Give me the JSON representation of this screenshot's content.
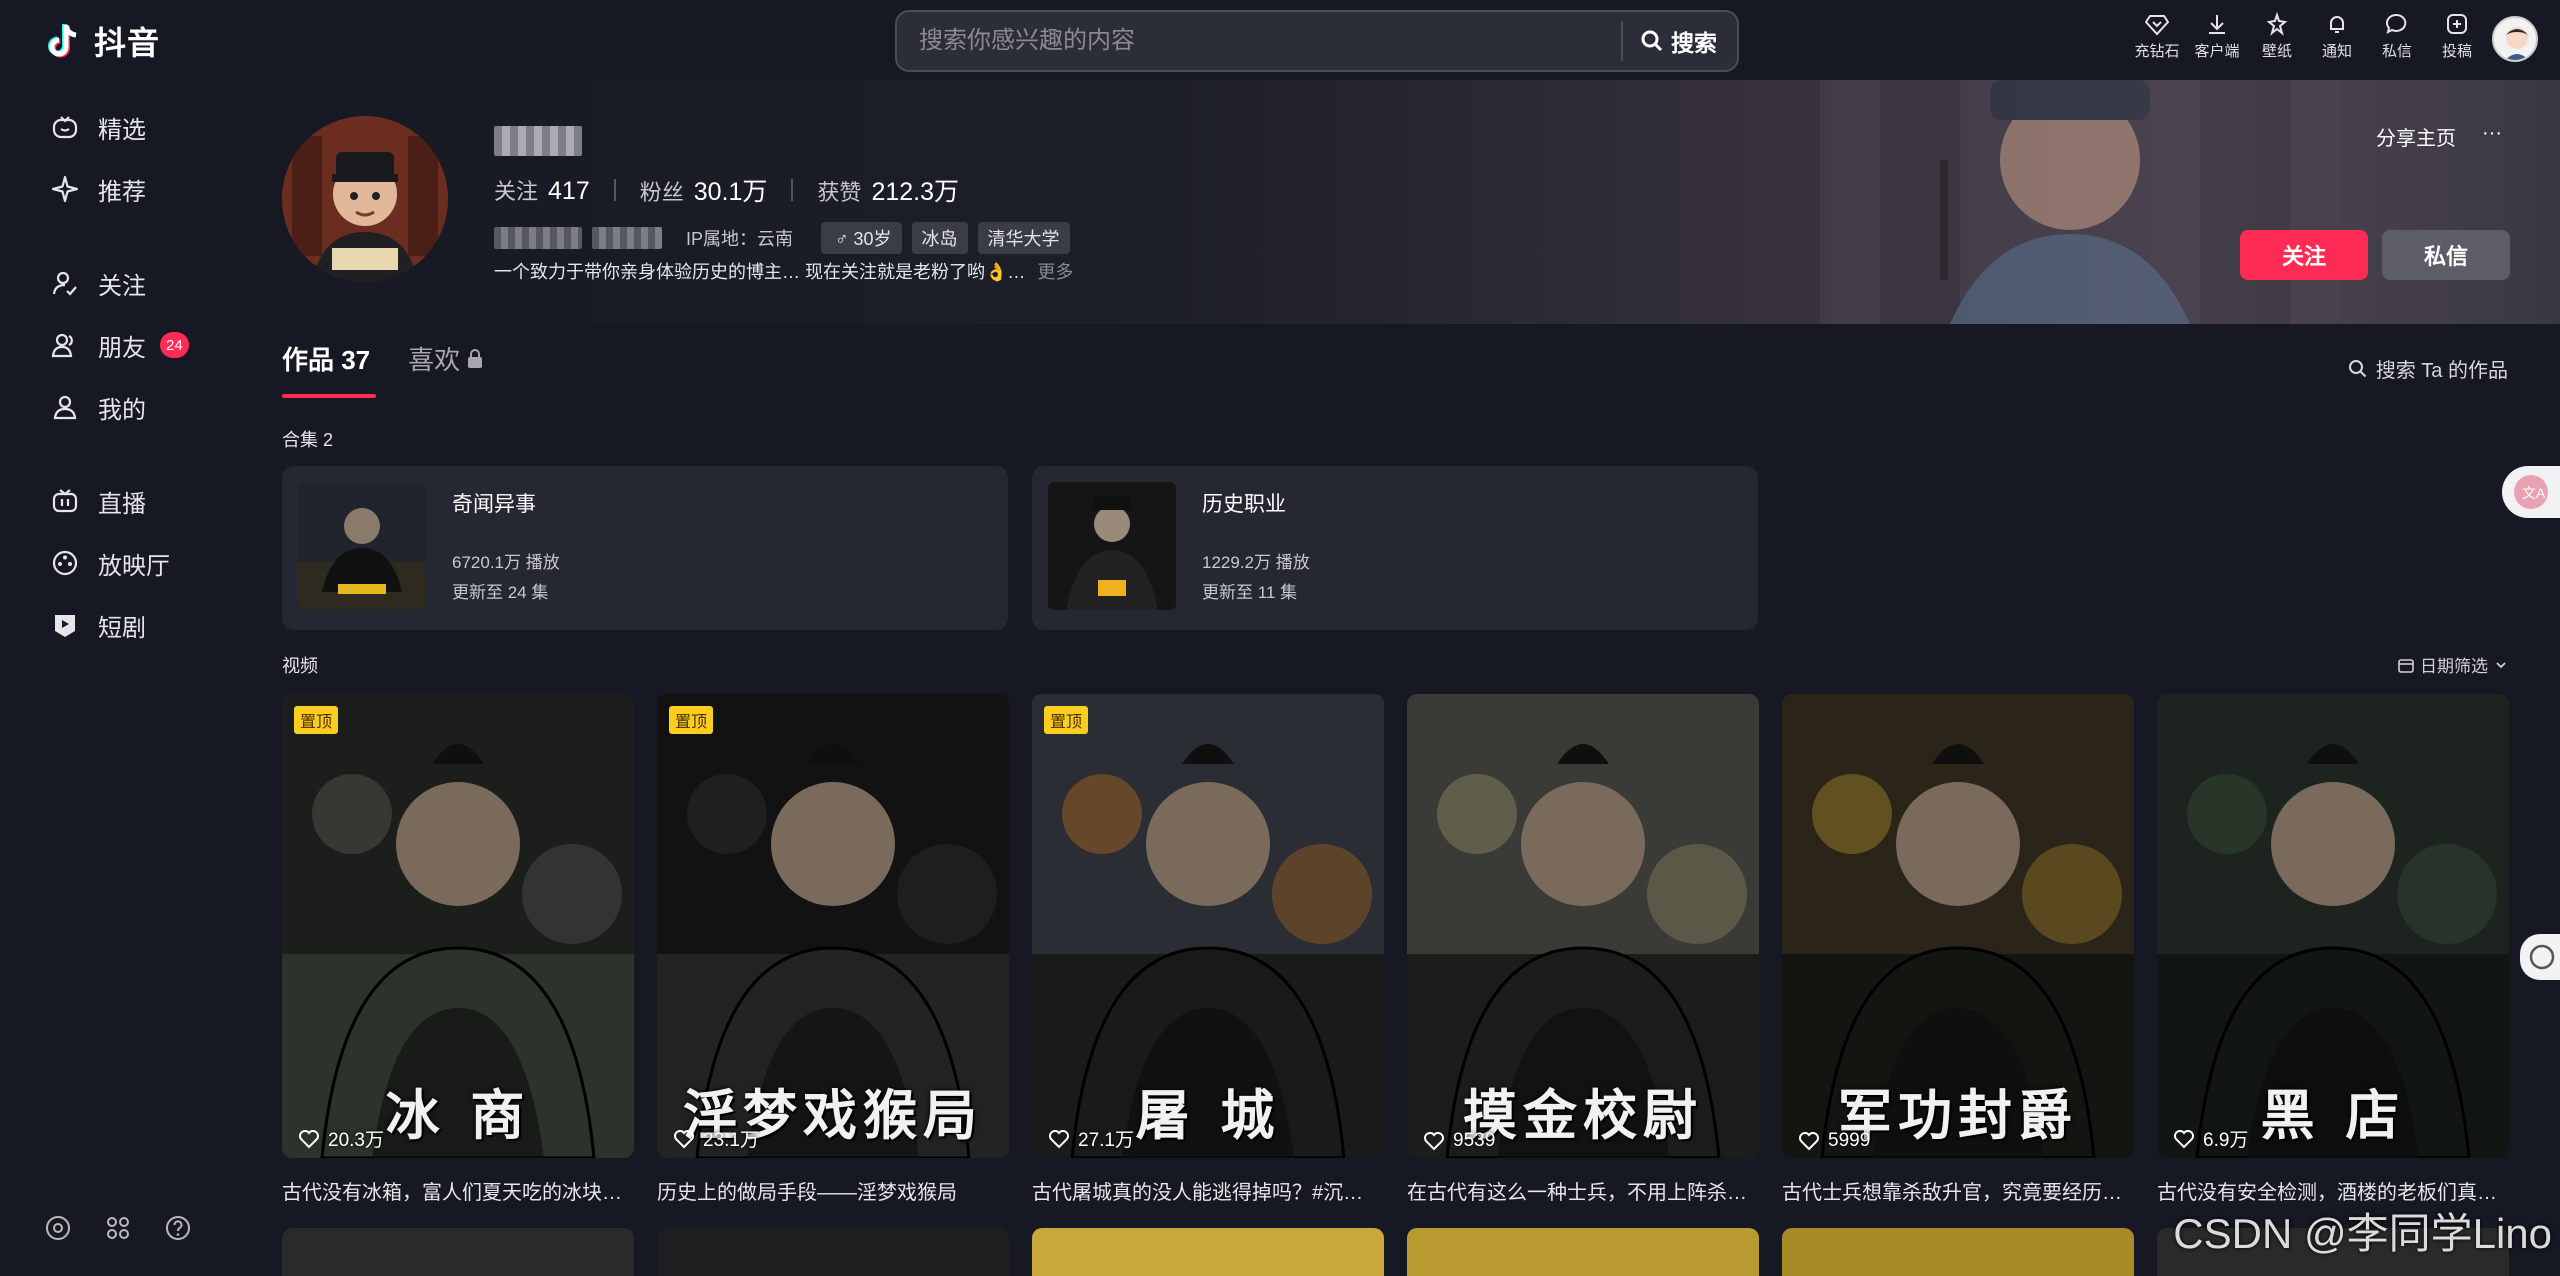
{
  "app": {
    "logo_text": "抖音"
  },
  "sidebar": {
    "items": [
      {
        "label": "精选",
        "icon": "tv-smile-icon"
      },
      {
        "label": "推荐",
        "icon": "sparkle-icon"
      },
      {
        "label": "关注",
        "icon": "user-follow-icon"
      },
      {
        "label": "朋友",
        "icon": "friends-icon",
        "badge": "24"
      },
      {
        "label": "我的",
        "icon": "user-icon"
      },
      {
        "label": "直播",
        "icon": "live-tv-icon"
      },
      {
        "label": "放映厅",
        "icon": "film-reel-icon"
      },
      {
        "label": "短剧",
        "icon": "play-bookmark-icon"
      }
    ]
  },
  "search": {
    "placeholder": "搜索你感兴趣的内容",
    "button_label": "搜索"
  },
  "top_icons": [
    {
      "label": "充钻石",
      "icon": "diamond-icon"
    },
    {
      "label": "客户端",
      "icon": "download-icon"
    },
    {
      "label": "壁纸",
      "icon": "wallpaper-icon"
    },
    {
      "label": "通知",
      "icon": "bell-icon"
    },
    {
      "label": "私信",
      "icon": "chat-icon"
    },
    {
      "label": "投稿",
      "icon": "upload-icon"
    }
  ],
  "profile": {
    "stats": [
      {
        "label": "关注",
        "value": "417"
      },
      {
        "label": "粉丝",
        "value": "30.1万"
      },
      {
        "label": "获赞",
        "value": "212.3万"
      }
    ],
    "ip": "IP属地：云南",
    "tags": [
      "♂ 30岁",
      "冰岛",
      "清华大学"
    ],
    "bio": "一个致力于带你亲身体验历史的博主… 现在关注就是老粉了哟👌…",
    "bio_more": "更多",
    "share_label": "分享主页",
    "more_label": "···",
    "follow_label": "关注",
    "message_label": "私信"
  },
  "tabs": [
    {
      "label": "作品 37",
      "active": true
    },
    {
      "label": "喜欢",
      "locked": true
    }
  ],
  "tab_search": "搜索 Ta 的作品",
  "collections_title": "合集 2",
  "collections": [
    {
      "title": "奇闻异事",
      "plays": "6720.1万 播放",
      "updates": "更新至 24 集"
    },
    {
      "title": "历史职业",
      "plays": "1229.2万 播放",
      "updates": "更新至 11 集"
    }
  ],
  "videos_title": "视频",
  "date_filter": "日期筛选",
  "videos": [
    {
      "pinned": "置顶",
      "overlay": "冰  商",
      "likes": "20.3万",
      "caption": "古代没有冰箱，富人们夏天吃的冰块…"
    },
    {
      "pinned": "置顶",
      "overlay": "淫梦戏猴局",
      "likes": "23.1万",
      "caption": "历史上的做局手段——淫梦戏猴局"
    },
    {
      "pinned": "置顶",
      "overlay": "屠  城",
      "likes": "27.1万",
      "caption": "古代屠城真的没人能逃得掉吗？#沉…"
    },
    {
      "pinned": "",
      "overlay": "摸金校尉",
      "likes": "9539",
      "caption": "在古代有这么一种士兵，不用上阵杀…"
    },
    {
      "pinned": "",
      "overlay": "军功封爵",
      "likes": "5999",
      "caption": "古代士兵想靠杀敌升官，究竟要经历…"
    },
    {
      "pinned": "",
      "overlay": "黑  店",
      "likes": "6.9万",
      "caption": "古代没有安全检测，酒楼的老板们真…"
    }
  ],
  "watermark": "CSDN @李同学Lino",
  "colors": {
    "accent": "#fe2c55",
    "background": "#161823",
    "card": "#252733",
    "pin": "#facd1f"
  }
}
